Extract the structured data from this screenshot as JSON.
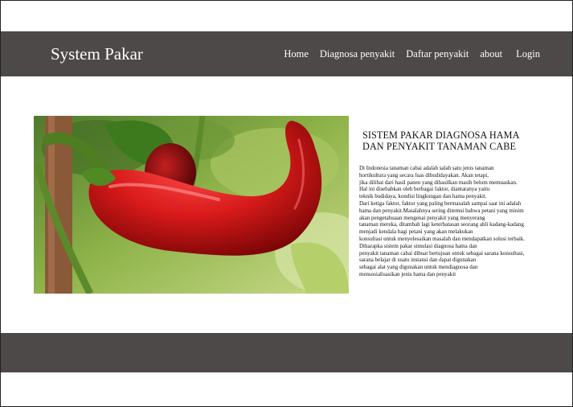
{
  "header": {
    "brand": "System Pakar",
    "nav": [
      "Home",
      "Diagnosa penyakit",
      "Daftar penyakit",
      "about",
      "Login"
    ]
  },
  "hero": {
    "image": "red-chili-pepper-photo"
  },
  "content": {
    "title_lines": [
      "SISTEM PAKAR DIAGNOSA HAMA",
      "DAN PENYAKIT TANAMAN CABE"
    ],
    "paragraph_lines": [
      "Di Indonesia tanaman cabai adalah salah satu jenis tanaman",
      "hortikultura yang secara luas dibudidayakan. Akan tetapi,",
      "jika dilihat dari hasil panen yang dihasilkan masih belum memuaskan.",
      "Hal ini disebabkan oleh berbagai faktor, diantaranya yaitu",
      " teknik budidaya, kondisi lingkungan dan hama penyakit.",
      "Dari ketiga faktor, faktor yang paling bermasalah sampai saat ini adalah",
      " hama dan penyakit.Masalahnya sering ditemui bahwa petani yang minim",
      "akan pengetahuaan mengenai penyakit yang menyerang",
      "tanaman mereka, ditambah lagi keterbatasan seorang ahli kadang-kadang",
      " menjadi kendala bagi petani yang akan melakukan",
      "konsultasi untuk menyelesaikan masalah dan mendapatkan solusi terbaik.",
      "Diharapka sistem pakar simulasi diagnosa hama dan",
      " penyakit tanaman cabai dibuat bertujuan untuk sebagai sarana konsultasi,",
      "sarana belajar di suatu instansi dan dapat digunakan",
      "sebagai alat yang digunakan untuk mendiagnosa dan",
      " mensosialisasikan jenis hama dan penyakit"
    ]
  },
  "colors": {
    "bar": "#4d4948",
    "background": "#ffffff",
    "text": "#111111"
  }
}
